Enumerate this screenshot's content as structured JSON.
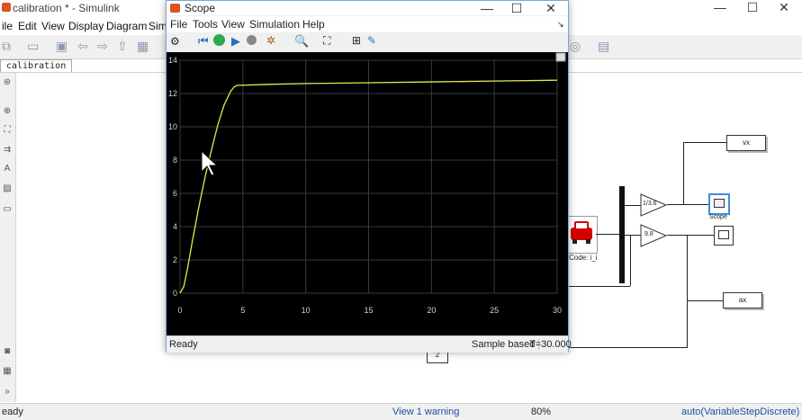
{
  "simulink": {
    "title": "calibration * - Simulink",
    "menu": [
      "ile",
      "Edit",
      "View",
      "Display",
      "Diagram",
      "Sim"
    ],
    "tab": "calibration",
    "status": {
      "left": "eady",
      "warning": "View 1 warning",
      "zoom": "80%",
      "solver": "auto(VariableStepDiscrete)"
    }
  },
  "blocks": {
    "vx": "vx",
    "ax": "ax",
    "gain1": "1/3.6",
    "gain2": "9.8",
    "scope_label": "Scope",
    "vehicle_label": "Code: i_i",
    "const_label": "2"
  },
  "scope": {
    "title": "Scope",
    "menu": [
      "File",
      "Tools",
      "View",
      "Simulation",
      "Help"
    ],
    "status_left": "Ready",
    "sample": "Sample based",
    "time": "T=30.000"
  },
  "chart_data": {
    "type": "line",
    "title": "",
    "xlabel": "",
    "ylabel": "",
    "xlim": [
      0,
      30
    ],
    "ylim": [
      0,
      14
    ],
    "xticks": [
      0,
      5,
      10,
      15,
      20,
      25,
      30
    ],
    "yticks": [
      0,
      2,
      4,
      6,
      8,
      10,
      12,
      14
    ],
    "grid": true,
    "series": [
      {
        "color": "#e8e84a",
        "x": [
          0,
          0.3,
          0.6,
          1,
          1.5,
          2,
          2.5,
          3,
          3.5,
          4,
          4.3,
          4.6,
          5,
          7,
          10,
          15,
          20,
          25,
          30
        ],
        "y": [
          0,
          0.4,
          1.5,
          3.2,
          5.2,
          7.0,
          8.6,
          10.1,
          11.3,
          12.1,
          12.4,
          12.5,
          12.5,
          12.55,
          12.6,
          12.65,
          12.7,
          12.75,
          12.8
        ]
      }
    ]
  }
}
